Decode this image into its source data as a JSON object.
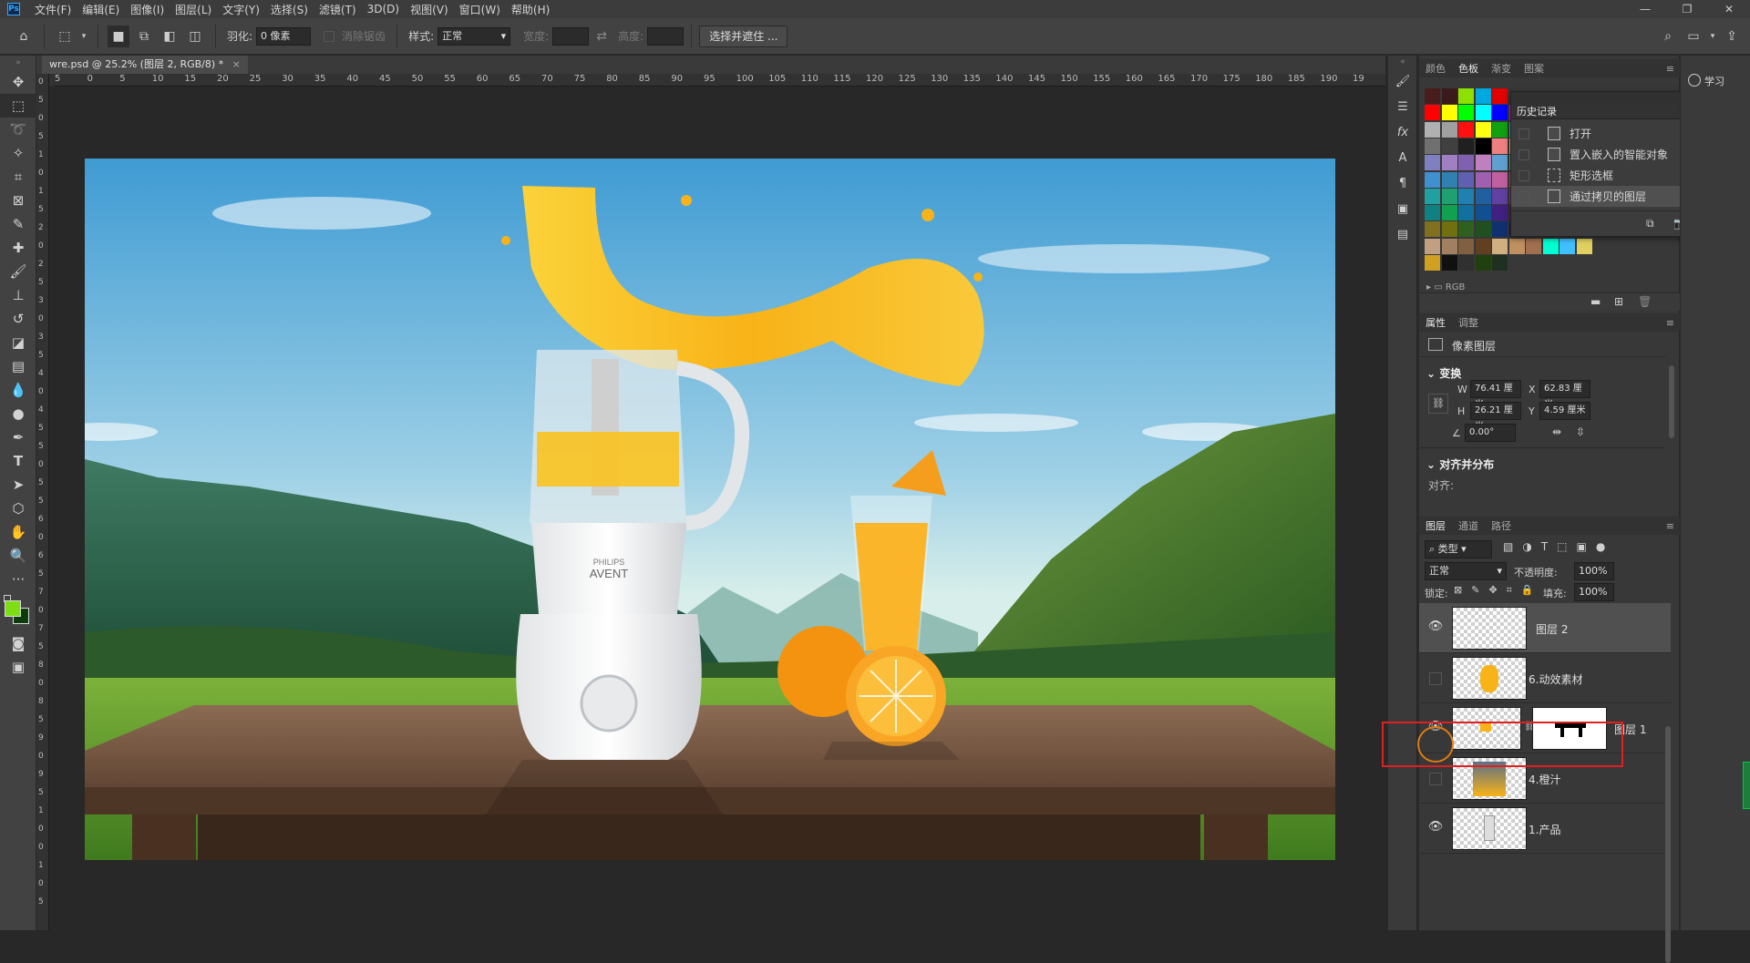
{
  "menu": [
    "文件(F)",
    "编辑(E)",
    "图像(I)",
    "图层(L)",
    "文字(Y)",
    "选择(S)",
    "滤镜(T)",
    "3D(D)",
    "视图(V)",
    "窗口(W)",
    "帮助(H)"
  ],
  "options": {
    "feather_label": "羽化:",
    "feather_value": "0 像素",
    "antialias": "消除锯齿",
    "style_label": "样式:",
    "style_value": "正常",
    "width_label": "宽度:",
    "height_label": "高度:",
    "select_mask_button": "选择并遮住 ..."
  },
  "document_tab": "wre.psd @ 25.2% (图层 2, RGB/8) *",
  "ruler": {
    "h": [
      "5",
      "0",
      "5",
      "10",
      "15",
      "20",
      "25",
      "30",
      "35",
      "40",
      "45",
      "50",
      "55",
      "60",
      "65",
      "70",
      "75",
      "80",
      "85",
      "90",
      "95",
      "100",
      "105",
      "110",
      "115",
      "120",
      "125",
      "130",
      "135",
      "140",
      "145",
      "150",
      "155",
      "160",
      "165",
      "170",
      "175",
      "180",
      "185",
      "190",
      "19"
    ],
    "v": [
      "0",
      "5",
      "0",
      "5",
      "1",
      "0",
      "1",
      "5",
      "2",
      "0",
      "2",
      "5",
      "3",
      "0",
      "3",
      "5",
      "4",
      "0",
      "4",
      "5",
      "5",
      "0",
      "5",
      "5",
      "6",
      "0",
      "6",
      "5",
      "7",
      "0",
      "7",
      "5",
      "8",
      "0",
      "8",
      "5",
      "9",
      "0",
      "9",
      "5",
      "1",
      "0",
      "0",
      "1",
      "0",
      "5"
    ]
  },
  "artwork": {
    "brand": "PHILIPS",
    "model": "AVENT"
  },
  "swatches_panel": {
    "tabs": [
      "颜色",
      "色板",
      "渐变",
      "图案"
    ],
    "active_tab": "色板",
    "group_label": "RGB"
  },
  "history": {
    "title": "历史记录",
    "items": [
      "打开",
      "置入嵌入的智能对象",
      "矩形选框",
      "通过拷贝的图层"
    ]
  },
  "properties": {
    "tabs": [
      "属性",
      "调整"
    ],
    "type": "像素图层",
    "transform_title": "变换",
    "w_label": "W",
    "w_value": "76.41 厘米",
    "x_label": "X",
    "x_value": "62.83 厘米",
    "h_label": "H",
    "h_value": "26.21 厘米",
    "y_label": "Y",
    "y_value": "4.59 厘米",
    "angle_value": "0.00°",
    "align_title": "对齐并分布",
    "align_label": "对齐:"
  },
  "layers_panel": {
    "tabs": [
      "图层",
      "通道",
      "路径"
    ],
    "kind_filter": "类型",
    "blend_mode": "正常",
    "opacity_label": "不透明度:",
    "opacity_value": "100%",
    "lock_label": "锁定:",
    "fill_label": "填充:",
    "fill_value": "100%",
    "layers": [
      {
        "name": "图层 2",
        "visible": true,
        "selected": true
      },
      {
        "name": "6.动效素材",
        "visible": false,
        "selected": false,
        "highlighted": true
      },
      {
        "name": "图层 1",
        "visible": true,
        "selected": false
      },
      {
        "name": "4.橙汁",
        "visible": false,
        "selected": false
      },
      {
        "name": "1.产品",
        "visible": true,
        "selected": false
      }
    ]
  },
  "far_right": {
    "learn_label": "学习"
  },
  "colors": {
    "foreground": "#7dde14",
    "background": "#0b3d0b",
    "highlight_box": "#e02020",
    "circle": "#e07a10"
  }
}
